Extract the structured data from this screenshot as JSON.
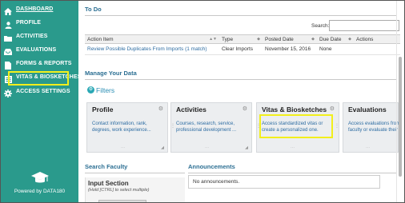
{
  "sidebar": {
    "items": [
      {
        "label": "DASHBOARD",
        "icon": "home-icon"
      },
      {
        "label": "PROFILE",
        "icon": "user-icon"
      },
      {
        "label": "ACTIVITIES",
        "icon": "folder-icon"
      },
      {
        "label": "EVALUATIONS",
        "icon": "inbox-icon"
      },
      {
        "label": "FORMS & REPORTS",
        "icon": "document-icon"
      },
      {
        "label": "VITAS & BIOSKETCHES",
        "icon": "list-icon"
      },
      {
        "label": "ACCESS SETTINGS",
        "icon": "gear-icon"
      }
    ],
    "footer": "Powered by DATA180",
    "accent_color": "#2a9a8c",
    "highlight_color": "#f2ef1c"
  },
  "todo": {
    "title": "To Do",
    "search_label": "Search:",
    "search_value": "",
    "columns": [
      "Action Item",
      "Type",
      "Posted Date",
      "Due Date",
      "Actions"
    ],
    "rows": [
      {
        "action_item": "Review Possible Duplicates From Imports (1 match)",
        "type": "Clear Imports",
        "posted_date": "November 15, 2016",
        "due_date": "None",
        "actions": ""
      }
    ]
  },
  "manage": {
    "title": "Manage Your Data",
    "filters_label": "Filters",
    "cards": [
      {
        "title": "Profile",
        "description": "Contact information, rank, degrees, work experience..."
      },
      {
        "title": "Activities",
        "description": "Courses, research, service, professional development ..."
      },
      {
        "title": "Vitas & Biosketches",
        "description": "Access standardized vitas or create a personalized one."
      },
      {
        "title": "Evaluations",
        "description": "Access evaluations from faculty or evaluate their"
      }
    ]
  },
  "search_faculty": {
    "title": "Search Faculty",
    "input_section_label": "Input Section",
    "input_section_hint": "(Hold [CTRL] to select multiple)"
  },
  "announcements": {
    "title": "Announcements",
    "empty_text": "No announcements."
  }
}
